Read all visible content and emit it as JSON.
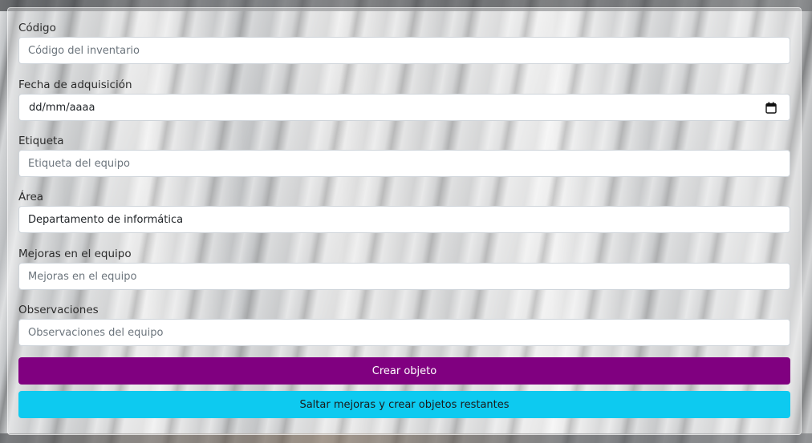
{
  "form": {
    "codigo": {
      "label": "Código",
      "placeholder": "Código del inventario",
      "value": ""
    },
    "fecha": {
      "label": "Fecha de adquisición",
      "value": "dd/mm/aaaa"
    },
    "etiqueta": {
      "label": "Etiqueta",
      "placeholder": "Etiqueta del equipo",
      "value": ""
    },
    "area": {
      "label": "Área",
      "placeholder": "",
      "value": "Departamento de informática"
    },
    "mejoras": {
      "label": "Mejoras en el equipo",
      "placeholder": "Mejoras en el equipo",
      "value": ""
    },
    "observaciones": {
      "label": "Observaciones",
      "placeholder": "Observaciones del equipo",
      "value": ""
    }
  },
  "buttons": {
    "crear": "Crear objeto",
    "saltar": "Saltar mejoras y crear objetos restantes"
  },
  "icons": {
    "calendar": "calendar-icon"
  },
  "colors": {
    "primary_button": "#800080",
    "info_button": "#0dcaf0"
  }
}
